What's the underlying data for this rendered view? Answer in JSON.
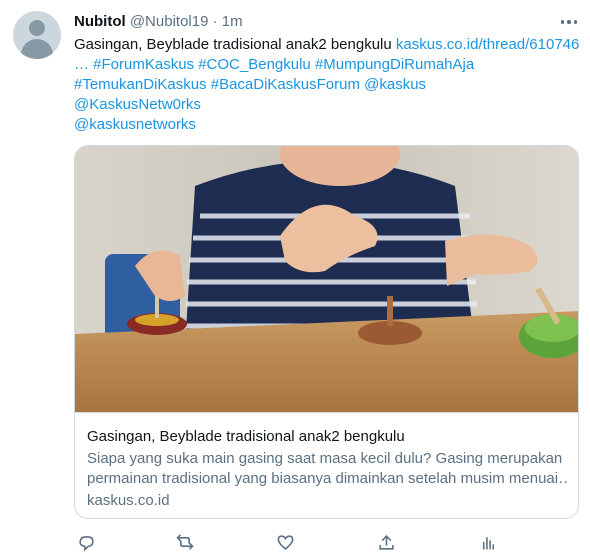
{
  "tweet": {
    "author_name": "Nubitol",
    "author_handle": "@Nubitol19",
    "separator": "·",
    "time": "1m",
    "text_plain": "Gasingan, Beyblade tradisional anak2 bengkulu ",
    "text_link": "kaskus.co.id/thread/610746c",
    "text_line2": "… #ForumKaskus #COC_Bengkulu #MumpungDiRumahAja",
    "text_line3": "#TemukanDiKaskus #BacaDiKaskusForum @kaskus",
    "text_line4": " @KaskusNetw0rks",
    "text_line5": " @kaskusnetworks"
  },
  "card": {
    "title": "Gasingan, Beyblade tradisional anak2 bengkulu",
    "description_line1": "Siapa yang suka main gasing saat masa kecil dulu? Gasing merupakan",
    "description_line2": "permainan tradisional yang biasanya dimainkan setelah musim menuai…",
    "domain": "kaskus.co.id"
  },
  "icons": {
    "reply": "reply-icon",
    "retweet": "retweet-icon",
    "like": "like-icon",
    "share": "share-icon",
    "analytics": "analytics-icon",
    "more": "more-icon"
  },
  "colors": {
    "link": "#1b95e0",
    "secondary_text": "#5b7083",
    "border": "#cfd9de"
  }
}
